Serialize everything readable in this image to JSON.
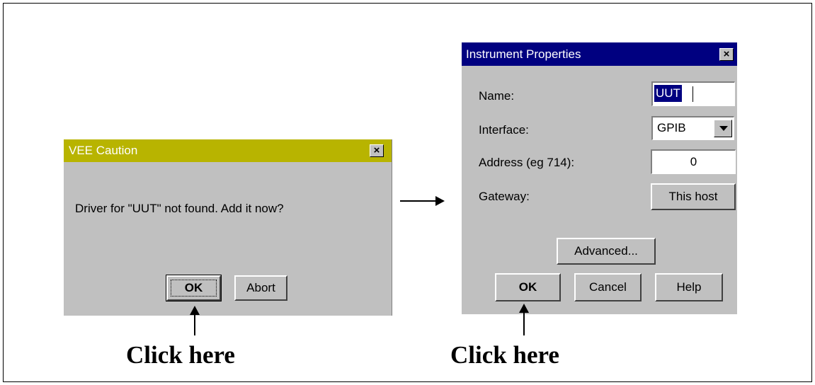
{
  "caution_dialog": {
    "title": "VEE Caution",
    "close_label": "×",
    "message": "Driver for \"UUT\" not found.  Add it now?",
    "ok_label": "OK",
    "abort_label": "Abort",
    "title_color": "#b8b400"
  },
  "properties_dialog": {
    "title": "Instrument Properties",
    "close_label": "×",
    "name_label": "Name:",
    "name_value": "UUT",
    "interface_label": "Interface:",
    "interface_value": "GPIB",
    "address_label": "Address (eg 714):",
    "address_value": "0",
    "gateway_label": "Gateway:",
    "gateway_value": "This host",
    "advanced_label": "Advanced...",
    "ok_label": "OK",
    "cancel_label": "Cancel",
    "help_label": "Help",
    "title_color": "#000080"
  },
  "annotations": {
    "caption_left": "Click here",
    "caption_right": "Click here"
  }
}
